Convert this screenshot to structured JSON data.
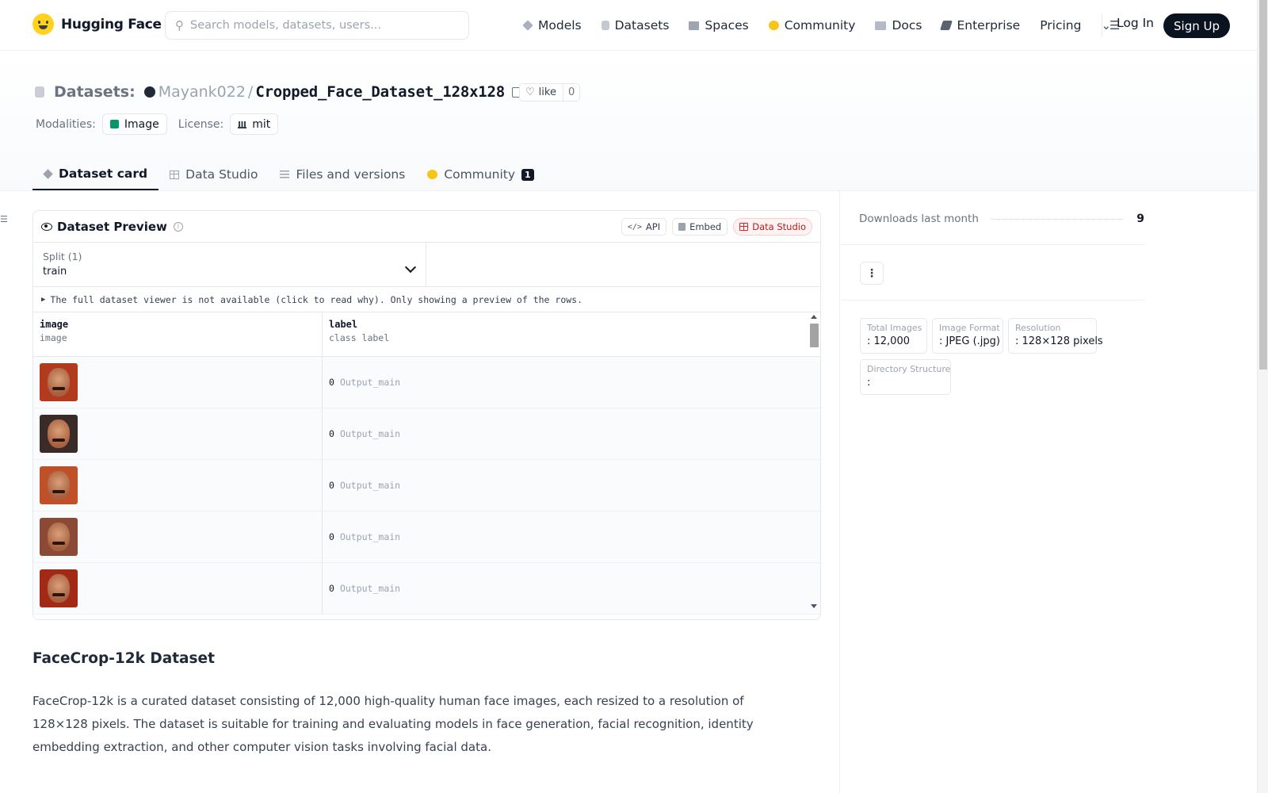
{
  "nav": {
    "brand": "Hugging Face",
    "search_placeholder": "Search models, datasets, users...",
    "links": [
      {
        "label": "Models",
        "icon": "models-icon"
      },
      {
        "label": "Datasets",
        "icon": "datasets-icon"
      },
      {
        "label": "Spaces",
        "icon": "spaces-icon"
      },
      {
        "label": "Community",
        "icon": "community-icon"
      },
      {
        "label": "Docs",
        "icon": "docs-icon"
      },
      {
        "label": "Enterprise",
        "icon": "enterprise-icon"
      },
      {
        "label": "Pricing",
        "icon": ""
      }
    ],
    "login": "Log In",
    "signup": "Sign Up"
  },
  "header": {
    "section": "Datasets:",
    "user": "Mayank022",
    "separator": "/",
    "dataset_name": "Cropped_Face_Dataset_128x128",
    "like_label": "like",
    "like_count": "0",
    "modalities_label": "Modalities:",
    "modality": "Image",
    "license_label": "License:",
    "license": "mit"
  },
  "tabs": [
    {
      "label": "Dataset card",
      "active": true
    },
    {
      "label": "Data Studio",
      "active": false
    },
    {
      "label": "Files and versions",
      "active": false
    },
    {
      "label": "Community",
      "active": false,
      "badge": "1"
    }
  ],
  "preview": {
    "title": "Dataset Preview",
    "buttons": {
      "api": "API",
      "embed": "Embed",
      "studio": "Data Studio"
    },
    "split_label": "Split (1)",
    "split_value": "train",
    "notice": "The full dataset viewer is not available (click to read why). Only showing a preview of the rows.",
    "columns": [
      {
        "name": "image",
        "type": "image"
      },
      {
        "name": "label",
        "type": "class label"
      }
    ],
    "rows": [
      {
        "label_num": "0",
        "label_name": "Output_main"
      },
      {
        "label_num": "0",
        "label_name": "Output_main"
      },
      {
        "label_num": "0",
        "label_name": "Output_main"
      },
      {
        "label_num": "0",
        "label_name": "Output_main"
      },
      {
        "label_num": "0",
        "label_name": "Output_main"
      }
    ]
  },
  "readme": {
    "heading": "FaceCrop-12k Dataset",
    "paragraph": "FaceCrop-12k is a curated dataset consisting of 12,000 high-quality human face images, each resized to a resolution of 128×128 pixels. The dataset is suitable for training and evaluating models in face generation, facial recognition, identity embedding extraction, and other computer vision tasks involving facial data."
  },
  "sidebar": {
    "downloads_label": "Downloads last month",
    "downloads_count": "9",
    "stats": [
      {
        "label": "Total Images",
        "value": ": 12,000"
      },
      {
        "label": "Image Format",
        "value": ": JPEG (.jpg)"
      },
      {
        "label": "Resolution",
        "value": ": 128×128 pixels"
      },
      {
        "label": "Directory Structure",
        "value": ":"
      }
    ]
  },
  "colors": {
    "accent_dark": "#0b1220",
    "studio_red": "#dc2626",
    "brand_yellow": "#ffd21e"
  }
}
